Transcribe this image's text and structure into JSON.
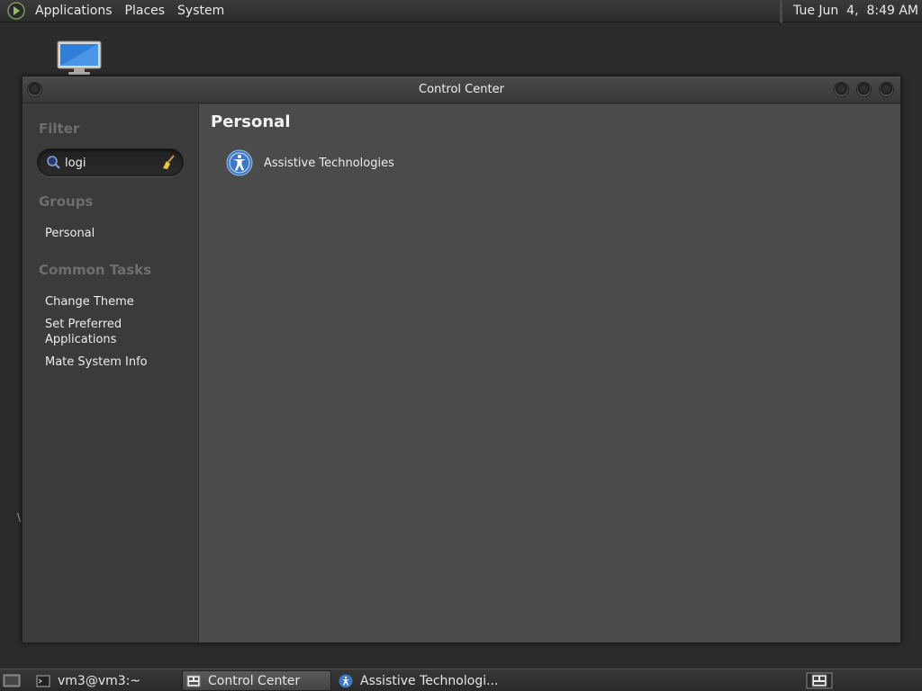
{
  "top_panel": {
    "menus": [
      "Applications",
      "Places",
      "System"
    ],
    "clock": "Tue Jun  4,  8:49 AM"
  },
  "window": {
    "title": "Control Center",
    "sidebar": {
      "filter_heading": "Filter",
      "search_value": "logi",
      "groups_heading": "Groups",
      "groups": [
        "Personal"
      ],
      "tasks_heading": "Common Tasks",
      "tasks": [
        "Change Theme",
        "Set Preferred Applications",
        "Mate System Info"
      ]
    },
    "content": {
      "group_title": "Personal",
      "items": [
        {
          "label": "Assistive Technologies",
          "icon": "accessibility-icon"
        }
      ]
    }
  },
  "taskbar": {
    "tasks": [
      "vm3@vm3:~",
      "Control Center",
      "Assistive Technologi..."
    ]
  },
  "colors": {
    "panel_bg": "#2c2c2c",
    "sidebar_bg": "#3b3b3b",
    "content_bg": "#4b4b4b",
    "accent_blue": "#3f78c2"
  }
}
